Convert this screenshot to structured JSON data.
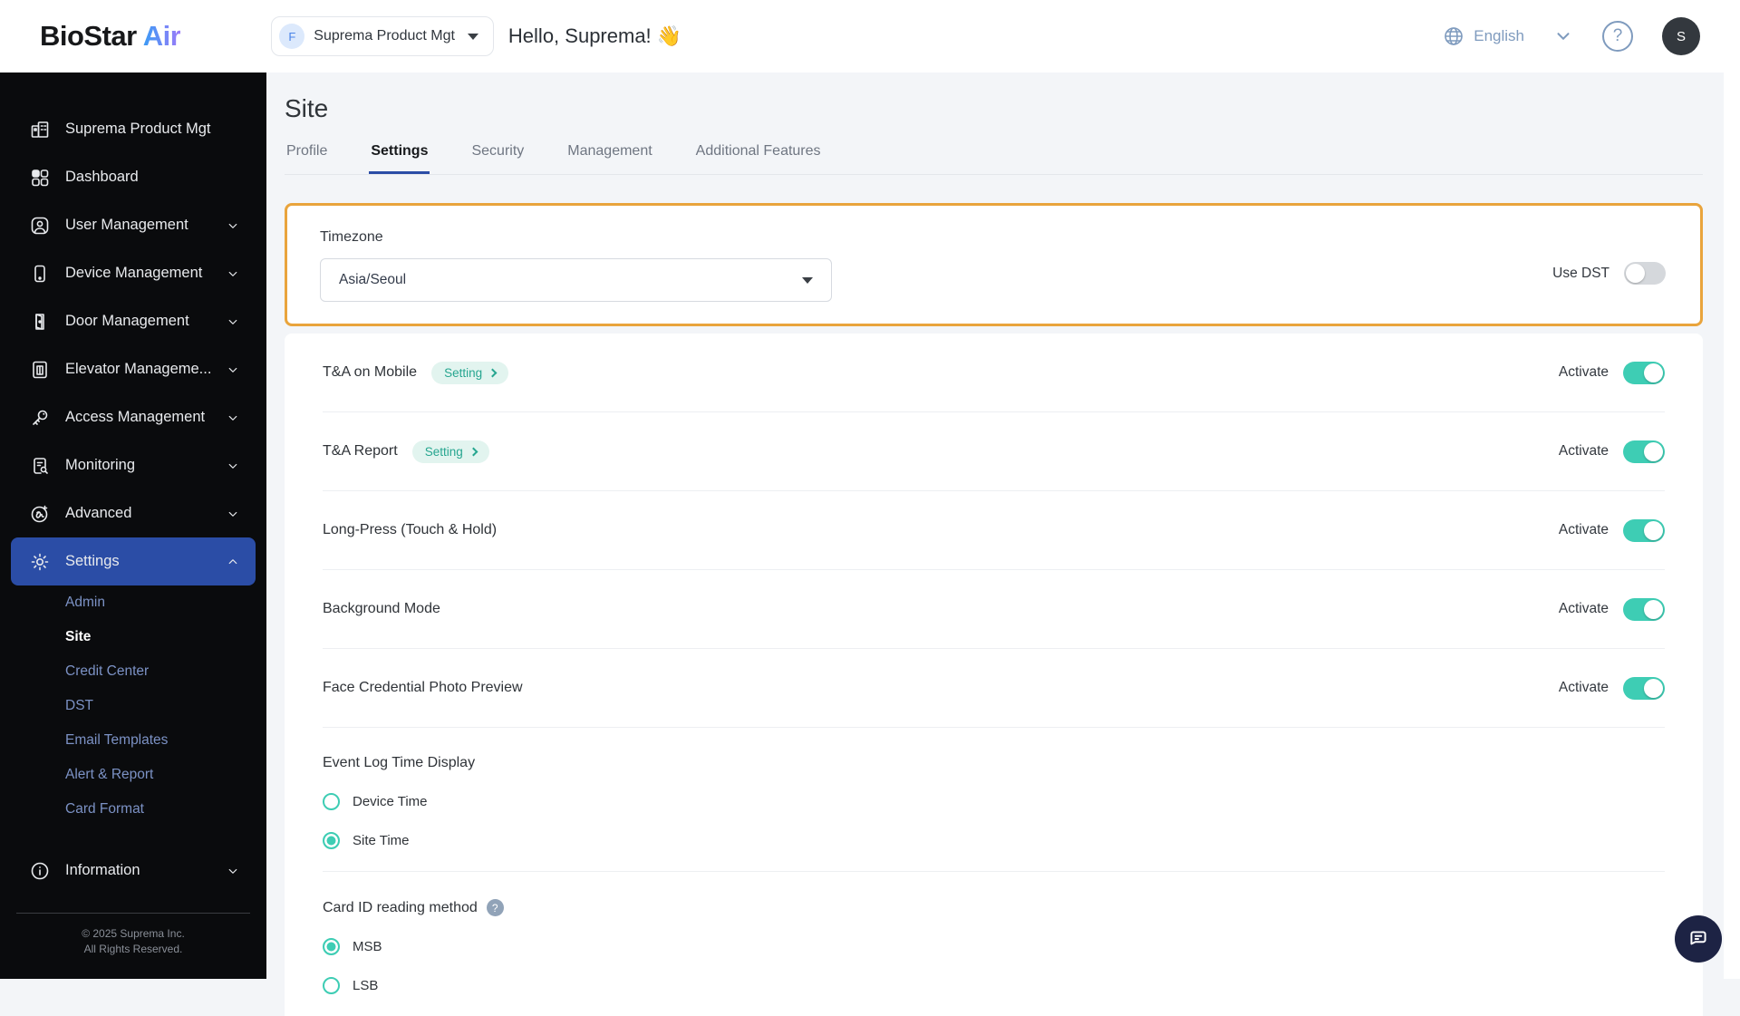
{
  "topbar": {
    "logo_primary": "BioStar",
    "logo_accent": "Air",
    "account_selector": {
      "badge": "F",
      "label": "Suprema Product Mgt"
    },
    "greeting_text": "Hello, Suprema!",
    "greeting_emoji": "👋",
    "language": "English",
    "help_glyph": "?",
    "avatar_initial": "S"
  },
  "sidebar": {
    "items": [
      {
        "label": "Suprema Product Mgt"
      },
      {
        "label": "Dashboard"
      },
      {
        "label": "User Management"
      },
      {
        "label": "Device Management"
      },
      {
        "label": "Door Management"
      },
      {
        "label": "Elevator Manageme..."
      },
      {
        "label": "Access Management"
      },
      {
        "label": "Monitoring"
      },
      {
        "label": "Advanced"
      },
      {
        "label": "Settings"
      }
    ],
    "settings_children": [
      {
        "label": "Admin"
      },
      {
        "label": "Site"
      },
      {
        "label": "Credit Center"
      },
      {
        "label": "DST"
      },
      {
        "label": "Email Templates"
      },
      {
        "label": "Alert & Report"
      },
      {
        "label": "Card Format"
      }
    ],
    "information_label": "Information",
    "copyright_line1": "© 2025 Suprema Inc.",
    "copyright_line2": "All Rights Reserved."
  },
  "main": {
    "page_title": "Site",
    "tabs": [
      {
        "label": "Profile"
      },
      {
        "label": "Settings"
      },
      {
        "label": "Security"
      },
      {
        "label": "Management"
      },
      {
        "label": "Additional Features"
      }
    ],
    "active_tab": "Settings",
    "timezone": {
      "label": "Timezone",
      "value": "Asia/Seoul",
      "dst_label": "Use DST",
      "dst_on": false
    },
    "rows": [
      {
        "label": "T&A on Mobile",
        "badge": "Setting",
        "toggle_label": "Activate",
        "on": true
      },
      {
        "label": "T&A Report",
        "badge": "Setting",
        "toggle_label": "Activate",
        "on": true
      },
      {
        "label": "Long-Press (Touch & Hold)",
        "badge": null,
        "toggle_label": "Activate",
        "on": true
      },
      {
        "label": "Background Mode",
        "badge": null,
        "toggle_label": "Activate",
        "on": true
      },
      {
        "label": "Face Credential Photo Preview",
        "badge": null,
        "toggle_label": "Activate",
        "on": true
      }
    ],
    "event_log": {
      "label": "Event Log Time Display",
      "options": [
        {
          "label": "Device Time",
          "selected": false
        },
        {
          "label": "Site Time",
          "selected": true
        }
      ]
    },
    "card_id": {
      "label": "Card ID reading method",
      "help_glyph": "?",
      "options": [
        {
          "label": "MSB",
          "selected": true
        },
        {
          "label": "LSB",
          "selected": false
        }
      ]
    }
  },
  "colors": {
    "accent_teal": "#3ECDB4",
    "active_nav_blue": "#2B4DA6",
    "highlight_orange": "#E9A43C",
    "sidebar_bg": "#0A0B0D",
    "page_bg": "#F3F5F8",
    "muted_link_blue": "#7C92C5",
    "topbar_icon_blue": "#7F9BBE"
  }
}
